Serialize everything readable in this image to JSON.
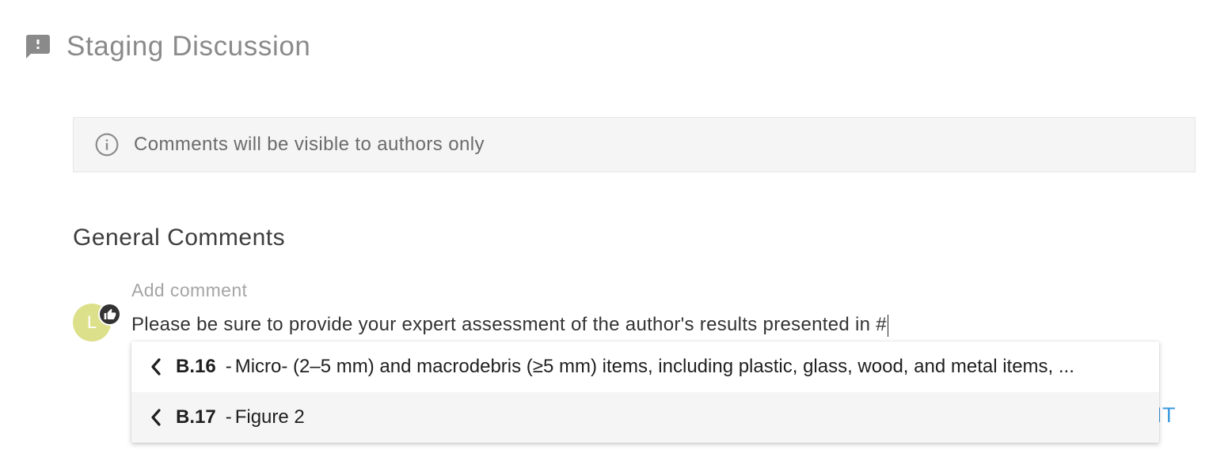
{
  "header": {
    "title": "Staging Discussion",
    "icon": "feedback-icon"
  },
  "banner": {
    "icon": "info-icon",
    "text": "Comments will be visible to authors only"
  },
  "section": {
    "title": "General Comments"
  },
  "comment": {
    "avatar_initial": "L",
    "badge_icon": "thumbs-up-icon",
    "label": "Add comment",
    "value": "Please be sure to provide your expert assessment of the author's results presented in #"
  },
  "suggestions": [
    {
      "code": "B.16",
      "separator": "-",
      "description": "Micro- (2–5 mm) and macrodebris (≥5 mm) items, including plastic, glass, wood, and metal items, ..."
    },
    {
      "code": "B.17",
      "separator": "-",
      "description": "Figure 2"
    }
  ],
  "submit_partial": "IT",
  "colors": {
    "accent": "#3b9ae0",
    "avatar": "#dde08a",
    "banner_bg": "#f5f5f5"
  }
}
